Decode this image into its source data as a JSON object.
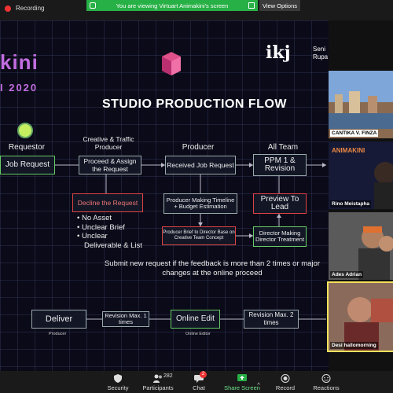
{
  "topbar": {
    "recording_label": "Recording",
    "share_banner": "You are viewing Virtuart Animakini's screen",
    "view_options": "View Options"
  },
  "slide": {
    "logo_left": "kini",
    "logo_year": "I 2020",
    "logo_ikj": "ikj",
    "logo_ikj_sub": [
      "Seni",
      "Rupa"
    ],
    "title": "STUDIO PRODUCTION FLOW",
    "columns": {
      "requestor": "Requestor",
      "creative": "Creative & Traffic Producer",
      "producer": "Producer",
      "all_team": "All Team"
    },
    "boxes": {
      "job_request": "Job Request",
      "proceed": "Proceed & Assign the Request",
      "received": "Received Job Request",
      "ppm": "PPM 1 & Revision",
      "decline": "Decline the Request",
      "producer_timeline": "Producer Making Timeline + Budget Estimation",
      "preview": "Preview To Lead",
      "brief_to_director": "Producer Brief to Director Base on Creative Team Concept",
      "director_treatment": "Director Making Director Treatment",
      "deliver": "Deliver",
      "revision1": "Revision Max. 1 times",
      "online_edit": "Online Edit",
      "revision2": "Revision Max. 2 times"
    },
    "bullets": [
      "No Asset",
      "Unclear Brief",
      "Unclear",
      "Deliverable & List"
    ],
    "note": "Submit new request if the feedback is more than 2 times or major changes at the online proceed",
    "labels": {
      "producer_small": "Producer",
      "online_editor_small": "Online Editor"
    }
  },
  "participants": [
    {
      "name": "CANTIKA V. FINZA",
      "bg": "#6b7fa8"
    },
    {
      "name": "Rino Meistapha",
      "bg": "#1a2240"
    },
    {
      "name": "Ades Adrian",
      "bg": "#3a3a3a"
    },
    {
      "name": "Desi hallomorning",
      "bg": "#6a4a3a"
    }
  ],
  "toolbar": {
    "security": "Security",
    "participants": "Participants",
    "participants_count": "282",
    "chat": "Chat",
    "chat_badge": "2",
    "share_screen": "Share Screen",
    "record": "Record",
    "reactions": "Reactions"
  },
  "colors": {
    "accent_green": "#27b045",
    "brand_purple": "#c16de0",
    "record_red": "#e33"
  }
}
